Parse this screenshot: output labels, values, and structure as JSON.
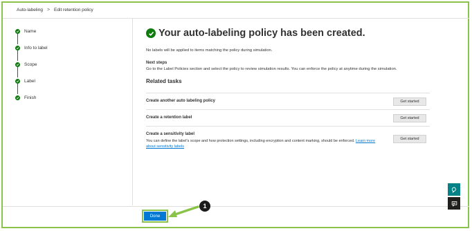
{
  "breadcrumb": {
    "items": [
      "Auto-labeling",
      "Edit retention policy"
    ],
    "separator": ">"
  },
  "steps": [
    {
      "label": "Name",
      "status": "complete"
    },
    {
      "label": "Info to label",
      "status": "complete"
    },
    {
      "label": "Scope",
      "status": "complete"
    },
    {
      "label": "Label",
      "status": "complete"
    },
    {
      "label": "Finish",
      "status": "complete"
    }
  ],
  "main": {
    "title": "Your auto-labeling policy has been created.",
    "simulation_note": "No labels will be applied to items matching the policy during simulation.",
    "next_steps_heading": "Next steps",
    "next_steps_text": "Go to the Label Policies section and select the policy to review simulation results. You can enforce the policy at anytime during the simulation.",
    "related_tasks_heading": "Related tasks",
    "tasks": [
      {
        "title": "Create another auto labeling policy",
        "button": "Get started"
      },
      {
        "title": "Create a retention label",
        "button": "Get started"
      },
      {
        "title": "Create a sensitivity label",
        "description": "You can define the label's scope and how protection settings, including encryption and content marking, should be enforced.",
        "link": "Learn more about sensitivity labels",
        "button": "Get started"
      }
    ]
  },
  "footer": {
    "done_label": "Done"
  },
  "callout": {
    "number": "1"
  },
  "side_buttons": [
    {
      "icon": "chat-bubble-icon"
    },
    {
      "icon": "feedback-icon"
    }
  ],
  "colors": {
    "success": "#107c10",
    "primary": "#0078d4",
    "highlight": "#8bc34a",
    "teal": "#038387"
  }
}
